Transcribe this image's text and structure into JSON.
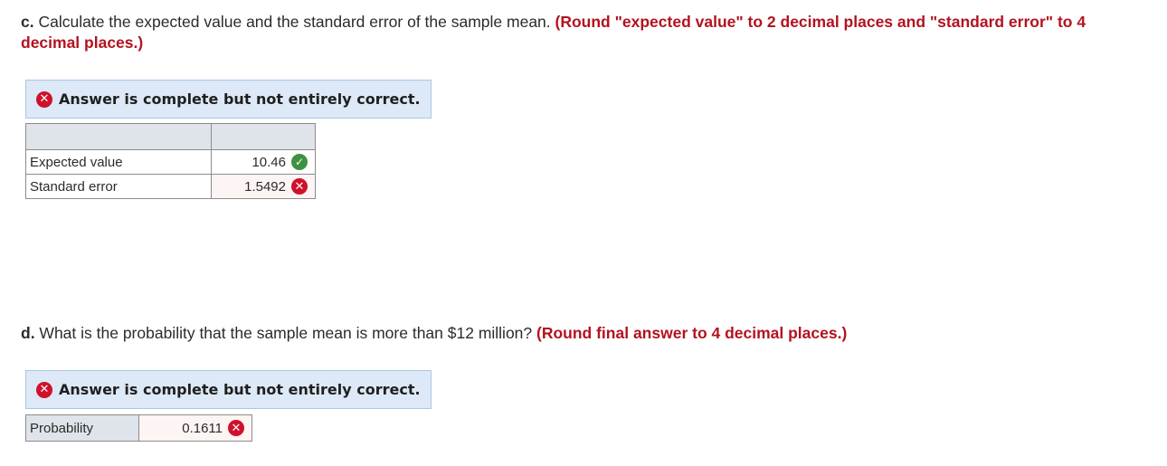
{
  "part_c": {
    "label": "c.",
    "question": " Calculate the expected value and the standard error of the sample mean. ",
    "hint": "(Round \"expected value\" to 2 decimal places and \"standard error\" to 4 decimal places.)",
    "banner": "Answer is complete but not entirely correct.",
    "rows": [
      {
        "label": "Expected value",
        "value": "10.46",
        "status": "correct"
      },
      {
        "label": "Standard error",
        "value": "1.5492",
        "status": "incorrect"
      }
    ]
  },
  "part_d": {
    "label": "d.",
    "question": " What is the probability that the sample mean is more than $12 million? ",
    "hint": "(Round final answer to 4 decimal places.)",
    "banner": "Answer is complete but not entirely correct.",
    "row": {
      "label": "Probability",
      "value": "0.1611",
      "status": "incorrect"
    }
  },
  "icons": {
    "correct": "check-circle-icon",
    "incorrect": "x-circle-icon"
  },
  "colors": {
    "hint": "#b3121f",
    "banner_bg": "#dde9f7",
    "correct": "#3f9142",
    "incorrect": "#d0112b"
  }
}
